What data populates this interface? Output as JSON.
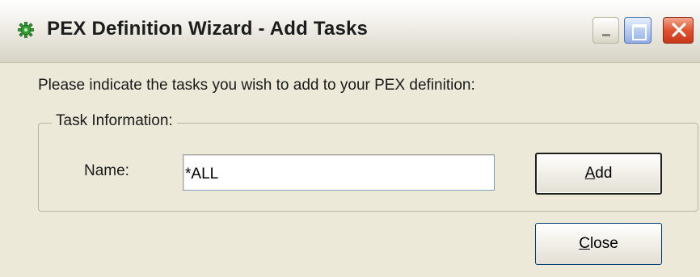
{
  "window": {
    "title": "PEX Definition Wizard - Add Tasks",
    "icon": "green-gear-icon",
    "controls": [
      "minimize-icon",
      "maximize-icon",
      "close-icon"
    ]
  },
  "instruction": "Please indicate the tasks you wish to add to your PEX definition:",
  "task_info": {
    "legend": "Task Information:",
    "name_label": "Name:",
    "name_value": "*ALL"
  },
  "buttons": {
    "add": {
      "accel": "A",
      "rest": "dd"
    },
    "close": {
      "accel": "C",
      "rest": "lose"
    }
  },
  "colors": {
    "dialog_bg": "#ece9d8",
    "close_button_red": "#e0532f",
    "icon_green": "#2f9e2f"
  }
}
